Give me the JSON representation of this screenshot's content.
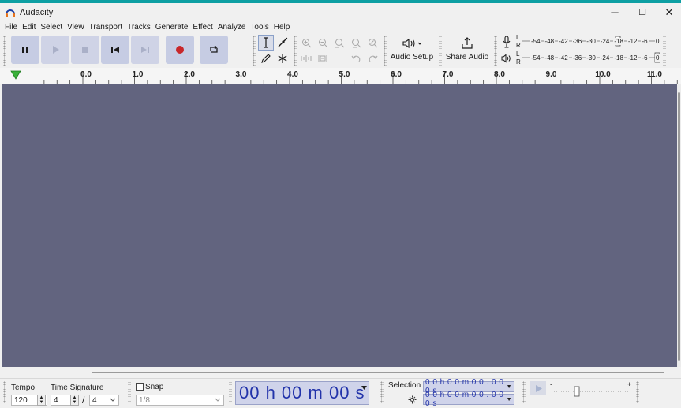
{
  "window": {
    "title": "Audacity",
    "minimize": "─",
    "maximize": "☐",
    "close": "✕"
  },
  "menu": [
    "File",
    "Edit",
    "Select",
    "View",
    "Transport",
    "Tracks",
    "Generate",
    "Effect",
    "Analyze",
    "Tools",
    "Help"
  ],
  "toolbar": {
    "audio_setup_label": "Audio Setup",
    "share_audio_label": "Share Audio",
    "meter_channel_l": "L",
    "meter_channel_r": "R",
    "meter_scale_record": [
      "-54",
      "-48",
      "-42",
      "-36",
      "-30",
      "-24",
      "-18",
      "-12",
      "-6",
      "0"
    ],
    "meter_scale_play": [
      "-54",
      "-48",
      "-42",
      "-36",
      "-30",
      "-24",
      "-18",
      "-12",
      "-6",
      "0"
    ]
  },
  "ruler": {
    "labels": [
      "0.0",
      "1.0",
      "2.0",
      "3.0",
      "4.0",
      "5.0",
      "6.0",
      "7.0",
      "8.0",
      "9.0",
      "10.0",
      "11.0"
    ]
  },
  "bottom": {
    "tempo_label": "Tempo",
    "tempo_value": "120",
    "time_signature_label": "Time Signature",
    "time_sig_upper": "4",
    "time_sig_slash": "/",
    "time_sig_lower": "4",
    "snap_label": "Snap",
    "snap_value": "1/8",
    "time_display": "00 h 00 m 00 s",
    "selection_label": "Selection",
    "selection_start": "0 0 h 0 0 m 0 0 . 0 0 0 s",
    "selection_end": "0 0 h 0 0 m 0 0 . 0 0 0 s",
    "speed_min": "-",
    "speed_max": "+"
  },
  "colors": {
    "accent": "#0d9fa3",
    "canvas": "#62647f",
    "button": "#c6cce3",
    "record": "#c8272a",
    "time_text": "#2233aa"
  }
}
